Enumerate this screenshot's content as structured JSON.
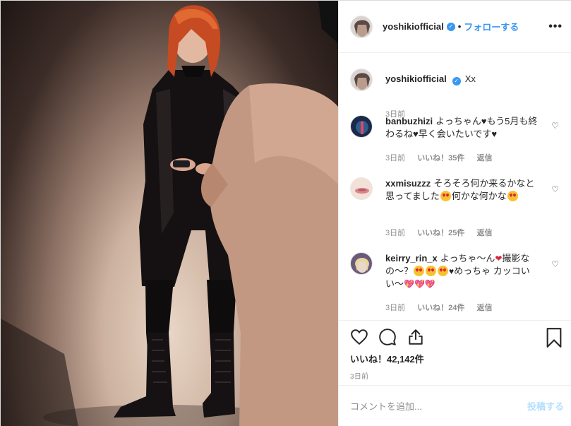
{
  "post": {
    "photo_alt": "",
    "likes_text": "いいね！42,142件",
    "time_ago": "3日前"
  },
  "header": {
    "username": "yoshikiofficial",
    "separator": "•",
    "follow_label": "フォローする",
    "more_label": "•••"
  },
  "caption": {
    "username": "yoshikiofficial",
    "text": "Xx",
    "time": "3日前"
  },
  "comments": [
    {
      "username": "banbuzhizi",
      "text": "よっちゃん♥もう5月も終わるね♥早く会いたいです♥",
      "time": "3日前",
      "likes": "いいね！35件",
      "reply": "返信"
    },
    {
      "username": "xxmisuzzz",
      "text_a": "そろそろ何か来るかなと思ってました",
      "text_b": "何かな何かな",
      "time": "3日前",
      "likes": "いいね！25件",
      "reply": "返信"
    },
    {
      "username": "keirry_rin_x",
      "text_a": "よっちゃ〜ん",
      "text_b": "撮影なの〜？",
      "text_c": "めっちゃ カッコいい〜",
      "time": "3日前",
      "likes": "いいね！24件",
      "reply": "返信"
    }
  ],
  "add_comment": {
    "placeholder": "コメントを追加...",
    "post_label": "投稿する"
  },
  "icons": {
    "like": "heart-outline-icon",
    "comment": "speech-bubble-icon",
    "share": "share-icon",
    "save": "bookmark-icon",
    "verified": "verified-badge-icon",
    "comment_like": "small-heart-icon"
  },
  "colors": {
    "link_blue": "#3897f0",
    "muted_text": "#8e8e8e",
    "border": "#efefef",
    "disabled_post": "#b2dffc"
  }
}
